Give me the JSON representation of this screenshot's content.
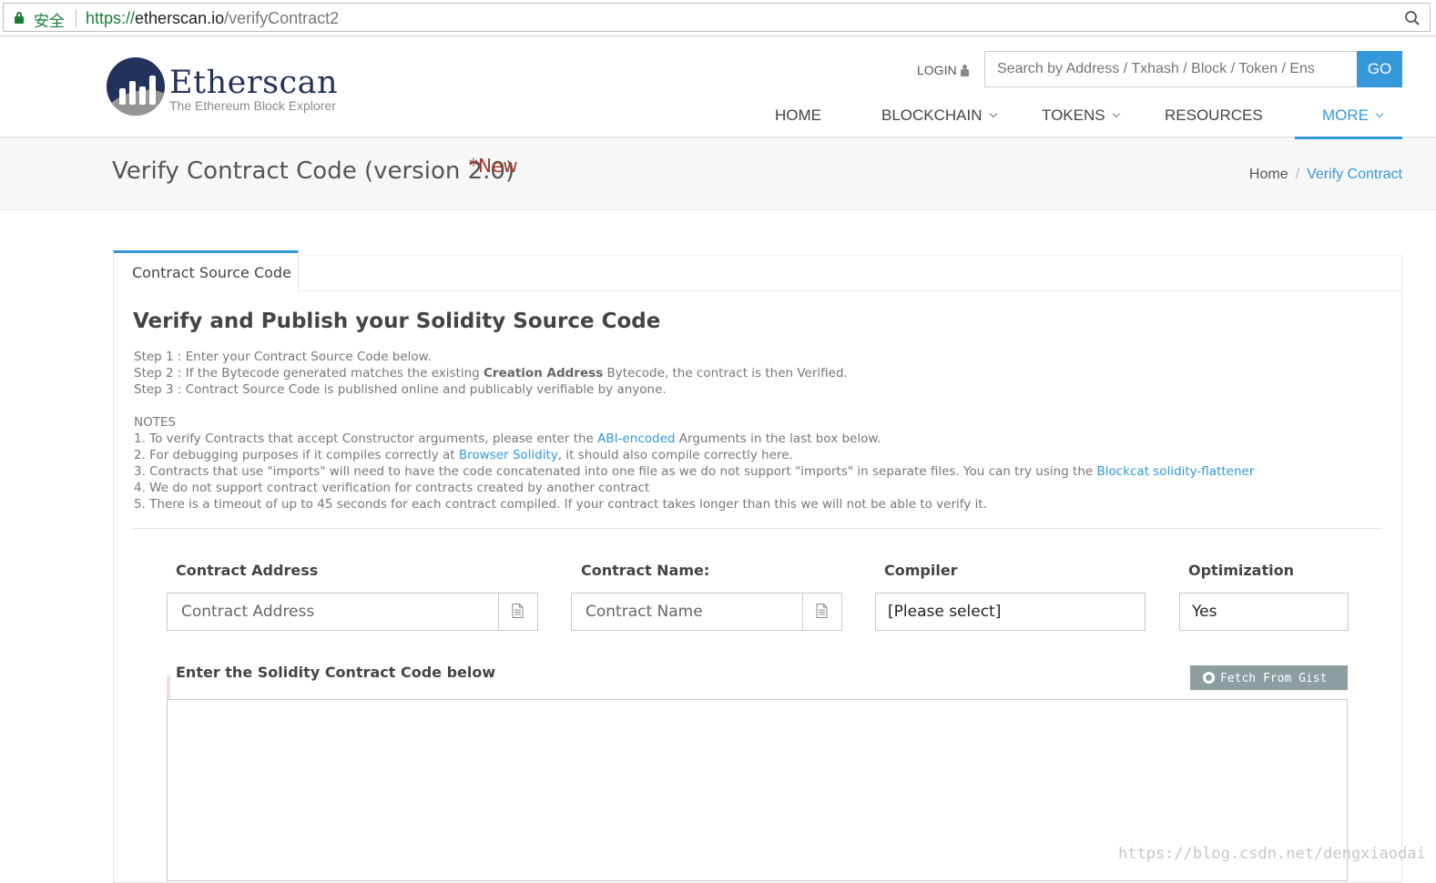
{
  "browser": {
    "secure_label": "安全",
    "url_scheme": "https://",
    "url_host": "etherscan.io",
    "url_path": "/verifyContract2"
  },
  "header": {
    "logo_name": "Etherscan",
    "logo_tagline": "The Ethereum Block Explorer",
    "login_label": "LOGIN",
    "search_placeholder": "Search by Address / Txhash / Block / Token / Ens",
    "go_label": "GO",
    "nav": [
      {
        "label": "HOME"
      },
      {
        "label": "BLOCKCHAIN"
      },
      {
        "label": "TOKENS"
      },
      {
        "label": "RESOURCES"
      },
      {
        "label": "MORE"
      }
    ],
    "accent_color": "#3498db"
  },
  "titlebar": {
    "title": "Verify Contract Code (version 2.0)",
    "new_badge": "*New",
    "breadcrumb_home": "Home",
    "breadcrumb_sep": "/",
    "breadcrumb_current": "Verify Contract"
  },
  "tab": {
    "label": "Contract Source Code"
  },
  "content": {
    "heading": "Verify and Publish your Solidity Source Code",
    "step1": "Step 1 : Enter your Contract Source Code below.",
    "step2_a": "Step 2 : If the Bytecode generated matches the existing ",
    "step2_bold": "Creation Address",
    "step2_b": " Bytecode, the contract is then Verified.",
    "step3": "Step 3 : Contract Source Code is published online and publicably verifiable by anyone.",
    "notes_title": "NOTES",
    "note1_a": "1. To verify Contracts that accept Constructor arguments, please enter the ",
    "note1_link": "ABI-encoded",
    "note1_b": " Arguments in the last box below.",
    "note2_a": "2. For debugging purposes if it compiles correctly at ",
    "note2_link": "Browser Solidity",
    "note2_b": ", it should also compile correctly here.",
    "note3_a": "3. Contracts that use \"imports\" will need to have the code concatenated into one file as we do not support \"imports\" in separate files. You can try using the ",
    "note3_link": "Blockcat solidity-flattener",
    "note4": "4. We do not support contract verification for contracts created by another contract",
    "note5": "5. There is a timeout of up to 45 seconds for each contract compiled. If your contract takes longer than this we will not be able to verify it."
  },
  "form": {
    "address_label": "Contract Address",
    "address_placeholder": "Contract Address",
    "name_label": "Contract Name:",
    "name_placeholder": "Contract Name",
    "compiler_label": "Compiler",
    "compiler_value": "[Please select]",
    "optimization_label": "Optimization",
    "optimization_value": "Yes",
    "code_label": "Enter the Solidity Contract Code below",
    "gist_button": "Fetch From Gist"
  },
  "watermark": "https://blog.csdn.net/dengxiaodai"
}
